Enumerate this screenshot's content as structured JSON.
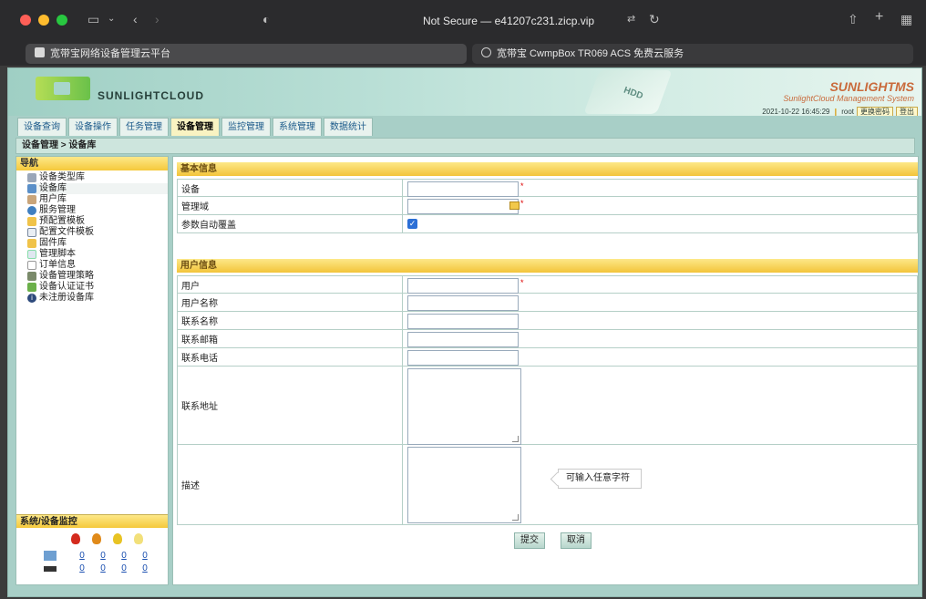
{
  "browser": {
    "url": "Not Secure — e41207c231.zicp.vip",
    "tabs": [
      {
        "label": "宽带宝网络设备管理云平台"
      },
      {
        "label": "宽带宝 CwmpBox TR069 ACS 免费云服务"
      }
    ]
  },
  "header": {
    "logo_text": "SUNLIGHTCLOUD",
    "product": "SUNLIGHTMS",
    "product_sub": "SunlightCloud Management System",
    "datetime": "2021-10-22 16:45:29",
    "user": "root",
    "change_password": "更换密码",
    "logout": "登出",
    "hdd_label": "HDD"
  },
  "nav": {
    "tabs": [
      {
        "label": "设备查询"
      },
      {
        "label": "设备操作"
      },
      {
        "label": "任务管理"
      },
      {
        "label": "设备管理"
      },
      {
        "label": "监控管理"
      },
      {
        "label": "系统管理"
      },
      {
        "label": "数据统计"
      }
    ],
    "active": "设备管理"
  },
  "breadcrumb": "设备管理 > 设备库",
  "sidebar": {
    "title": "导航",
    "items": [
      {
        "label": "设备类型库",
        "icon": "device-type-icon"
      },
      {
        "label": "设备库",
        "icon": "device-library-icon"
      },
      {
        "label": "用户库",
        "icon": "user-library-icon"
      },
      {
        "label": "服务管理",
        "icon": "globe-icon"
      },
      {
        "label": "预配置模板",
        "icon": "folder-icon"
      },
      {
        "label": "配置文件模板",
        "icon": "config-file-icon"
      },
      {
        "label": "固件库",
        "icon": "folder-icon"
      },
      {
        "label": "管理脚本",
        "icon": "script-icon"
      },
      {
        "label": "订单信息",
        "icon": "document-icon"
      },
      {
        "label": "设备管理策略",
        "icon": "policy-icon"
      },
      {
        "label": "设备认证证书",
        "icon": "certificate-icon"
      },
      {
        "label": "未注册设备库",
        "icon": "info-icon"
      }
    ]
  },
  "monitor": {
    "title": "系统/设备监控",
    "rows": [
      {
        "counts": [
          "0",
          "0",
          "0",
          "0"
        ]
      },
      {
        "counts": [
          "0",
          "0",
          "0",
          "0"
        ]
      }
    ],
    "colors": [
      "#d42b1e",
      "#e08a1a",
      "#e8c323",
      "#f2e07a"
    ]
  },
  "form": {
    "basic_title": "基本信息",
    "basic_fields": [
      {
        "label": "设备"
      },
      {
        "label": "管理域"
      },
      {
        "label": "参数自动覆盖"
      }
    ],
    "user_title": "用户信息",
    "user_fields": [
      {
        "label": "用户"
      },
      {
        "label": "用户名称"
      },
      {
        "label": "联系名称"
      },
      {
        "label": "联系邮箱"
      },
      {
        "label": "联系电话"
      },
      {
        "label": "联系地址"
      },
      {
        "label": "描述"
      }
    ],
    "tooltip": "可输入任意字符",
    "submit": "提交",
    "cancel": "取消"
  }
}
